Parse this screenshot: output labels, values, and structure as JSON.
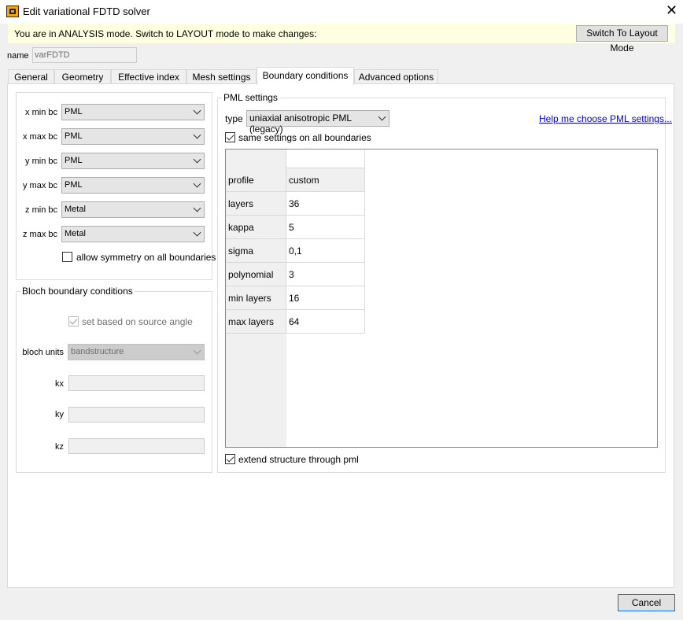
{
  "window": {
    "title": "Edit variational FDTD solver",
    "close_icon": "close-icon"
  },
  "banner": {
    "text": "You are in ANALYSIS mode.  Switch to LAYOUT mode to make changes:",
    "button_label": "Switch To Layout Mode"
  },
  "name_field": {
    "label": "name",
    "value": "varFDTD"
  },
  "tabs": [
    {
      "label": "General"
    },
    {
      "label": "Geometry"
    },
    {
      "label": "Effective index"
    },
    {
      "label": "Mesh settings"
    },
    {
      "label": "Boundary conditions",
      "active": true
    },
    {
      "label": "Advanced options"
    }
  ],
  "boundaries": [
    {
      "label": "x min bc",
      "value": "PML"
    },
    {
      "label": "x max bc",
      "value": "PML"
    },
    {
      "label": "y min bc",
      "value": "PML"
    },
    {
      "label": "y max bc",
      "value": "PML"
    },
    {
      "label": "z min bc",
      "value": "Metal"
    },
    {
      "label": "z max bc",
      "value": "Metal"
    }
  ],
  "allow_symmetry": {
    "label": "allow symmetry on all boundaries",
    "checked": false
  },
  "bloch": {
    "title": "Bloch boundary conditions",
    "set_based_label": "set based on source angle",
    "set_based_checked": true,
    "units_label": "bloch units",
    "units_value": "bandstructure",
    "kx_label": "kx",
    "ky_label": "ky",
    "kz_label": "kz"
  },
  "pml": {
    "title": "PML settings",
    "type_label": "type",
    "type_value": "uniaxial anisotropic PML (legacy)",
    "help_link": "Help me choose PML settings...",
    "same_settings_label": "same settings on all boundaries",
    "same_settings_checked": true,
    "rows": [
      {
        "key": "profile",
        "value": "custom"
      },
      {
        "key": "layers",
        "value": "36"
      },
      {
        "key": "kappa",
        "value": "5"
      },
      {
        "key": "sigma",
        "value": "0,1"
      },
      {
        "key": "polynomial",
        "value": "3"
      },
      {
        "key": "min layers",
        "value": "16"
      },
      {
        "key": "max layers",
        "value": "64"
      }
    ],
    "extend_label": "extend structure through pml",
    "extend_checked": true
  },
  "footer": {
    "cancel_label": "Cancel"
  }
}
